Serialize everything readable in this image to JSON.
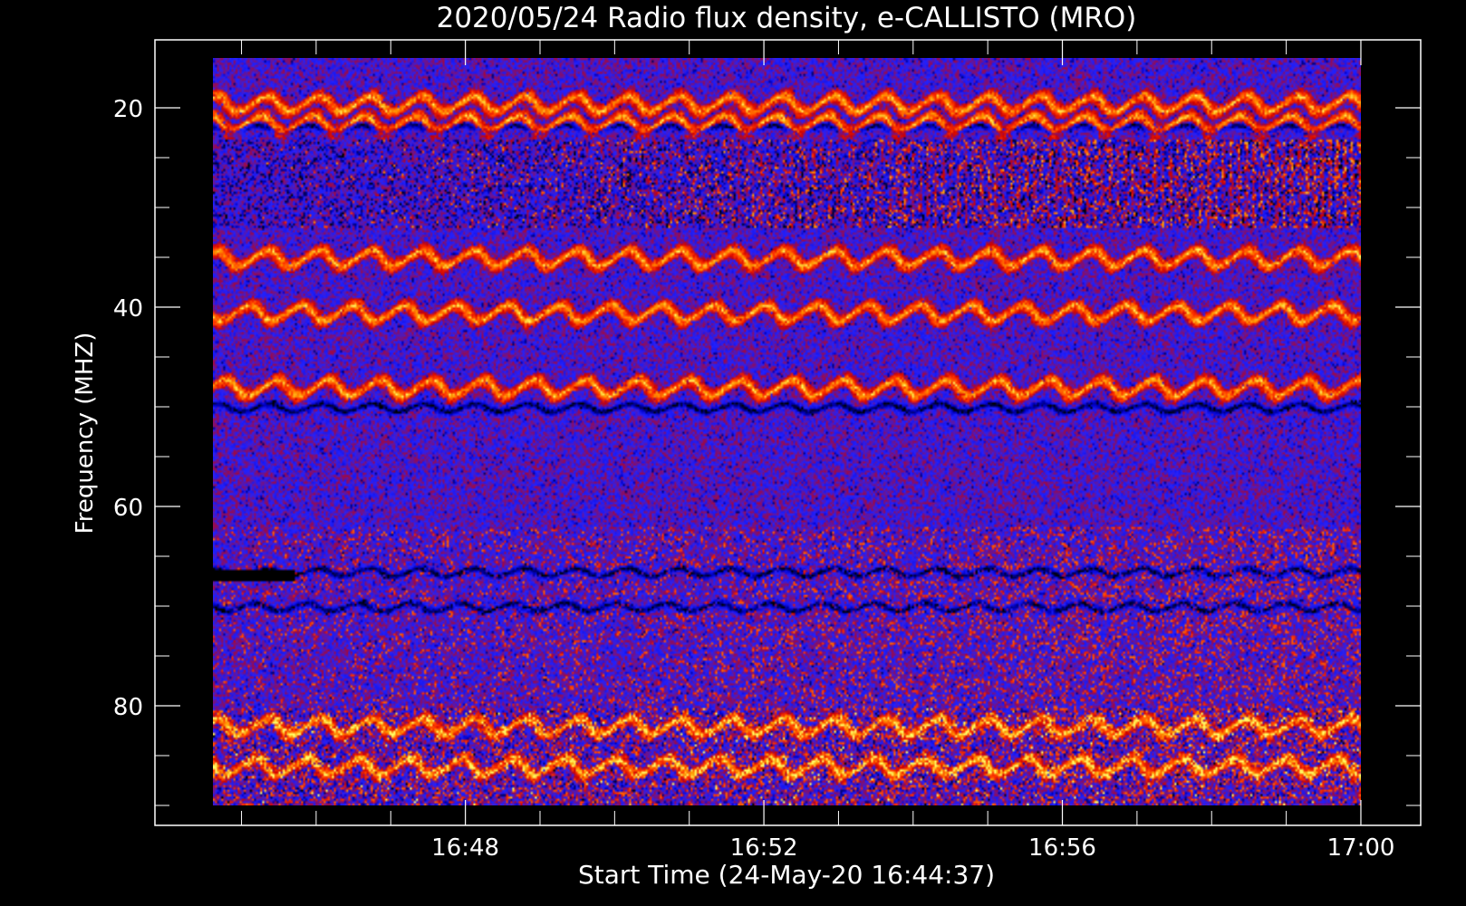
{
  "chart_data": {
    "type": "heatmap",
    "title": "2020/05/24  Radio flux density, e-CALLISTO (MRO)",
    "xlabel": "Start Time (24-May-20 16:44:37)",
    "ylabel": "Frequency (MHZ)",
    "x_start": "16:44:37",
    "x_end": "17:00:00",
    "y_range_mhz": [
      15,
      90
    ],
    "y_inverted": true,
    "x_ticks": [
      {
        "label": "16:48",
        "minutes": 3.383
      },
      {
        "label": "16:52",
        "minutes": 7.383
      },
      {
        "label": "16:56",
        "minutes": 11.383
      },
      {
        "label": "17:00",
        "minutes": 15.383
      }
    ],
    "y_ticks": [
      {
        "label": "20",
        "mhz": 20
      },
      {
        "label": "40",
        "mhz": 40
      },
      {
        "label": "60",
        "mhz": 60
      },
      {
        "label": "80",
        "mhz": 80
      }
    ],
    "colormap": [
      "#000000",
      "#0000cc",
      "#2222ff",
      "#cc0000",
      "#ff3300",
      "#ff9900",
      "#ffff66"
    ],
    "bright_bands_mhz": [
      19.5,
      21.5,
      35,
      40.5,
      48,
      82,
      86
    ],
    "dark_bands_mhz": [
      22,
      50,
      66.5,
      70
    ],
    "legend": "none",
    "grid": false
  }
}
